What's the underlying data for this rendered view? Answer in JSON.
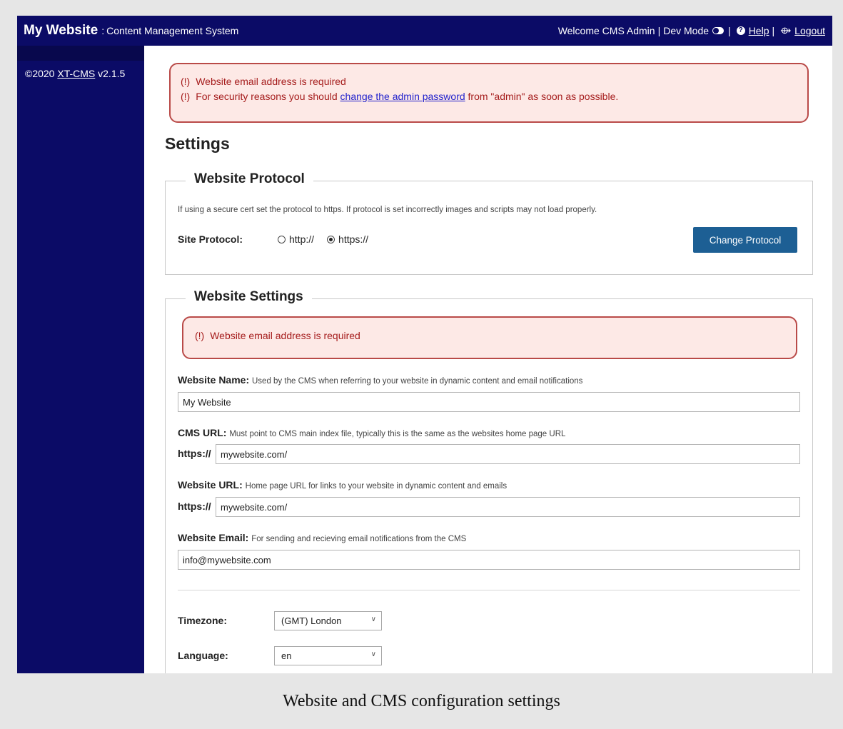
{
  "header": {
    "site_name": "My Website",
    "separator": ":",
    "subtitle": "Content Management System",
    "welcome": "Welcome CMS Admin",
    "dev_mode": "Dev Mode",
    "help": "Help",
    "logout": "Logout",
    "pipe": "|"
  },
  "sidebar": {
    "copyright": "©2020",
    "product": "XT-CMS",
    "version": "v2.1.5"
  },
  "alerts": {
    "marker": "(!)",
    "email_required": "Website email address is required",
    "security_prefix": "For security reasons you should",
    "security_link": "change the admin password",
    "security_suffix": "from \"admin\" as soon as possible."
  },
  "page": {
    "title": "Settings"
  },
  "protocol": {
    "legend": "Website Protocol",
    "hint": "If using a secure cert set the protocol to https. If protocol is set incorrectly images and scripts may not load properly.",
    "label": "Site Protocol:",
    "options": [
      "http://",
      "https://"
    ],
    "selected": "https://",
    "button": "Change Protocol"
  },
  "settings": {
    "legend": "Website Settings",
    "website_name": {
      "label": "Website Name:",
      "desc": "Used by the CMS when referring to your website in dynamic content and email notifications",
      "value": "My Website"
    },
    "cms_url": {
      "label": "CMS URL:",
      "desc": "Must point to CMS main index file, typically this is the same as the websites home page URL",
      "prefix": "https://",
      "value": "mywebsite.com/"
    },
    "website_url": {
      "label": "Website URL:",
      "desc": "Home page URL for links to your website in dynamic content and emails",
      "prefix": "https://",
      "value": "mywebsite.com/"
    },
    "website_email": {
      "label": "Website Email:",
      "desc": "For sending and recieving email notifications from the CMS",
      "value": "info@mywebsite.com"
    },
    "timezone": {
      "label": "Timezone:",
      "value": "(GMT) London"
    },
    "language": {
      "label": "Language:",
      "value": "en"
    }
  },
  "caption": "Website and CMS configuration settings",
  "colors": {
    "navy": "#0b0b66",
    "alert_bg": "#fde9e6",
    "alert_border": "#b94a48",
    "alert_text": "#a51c1c",
    "button": "#1d5f94"
  }
}
